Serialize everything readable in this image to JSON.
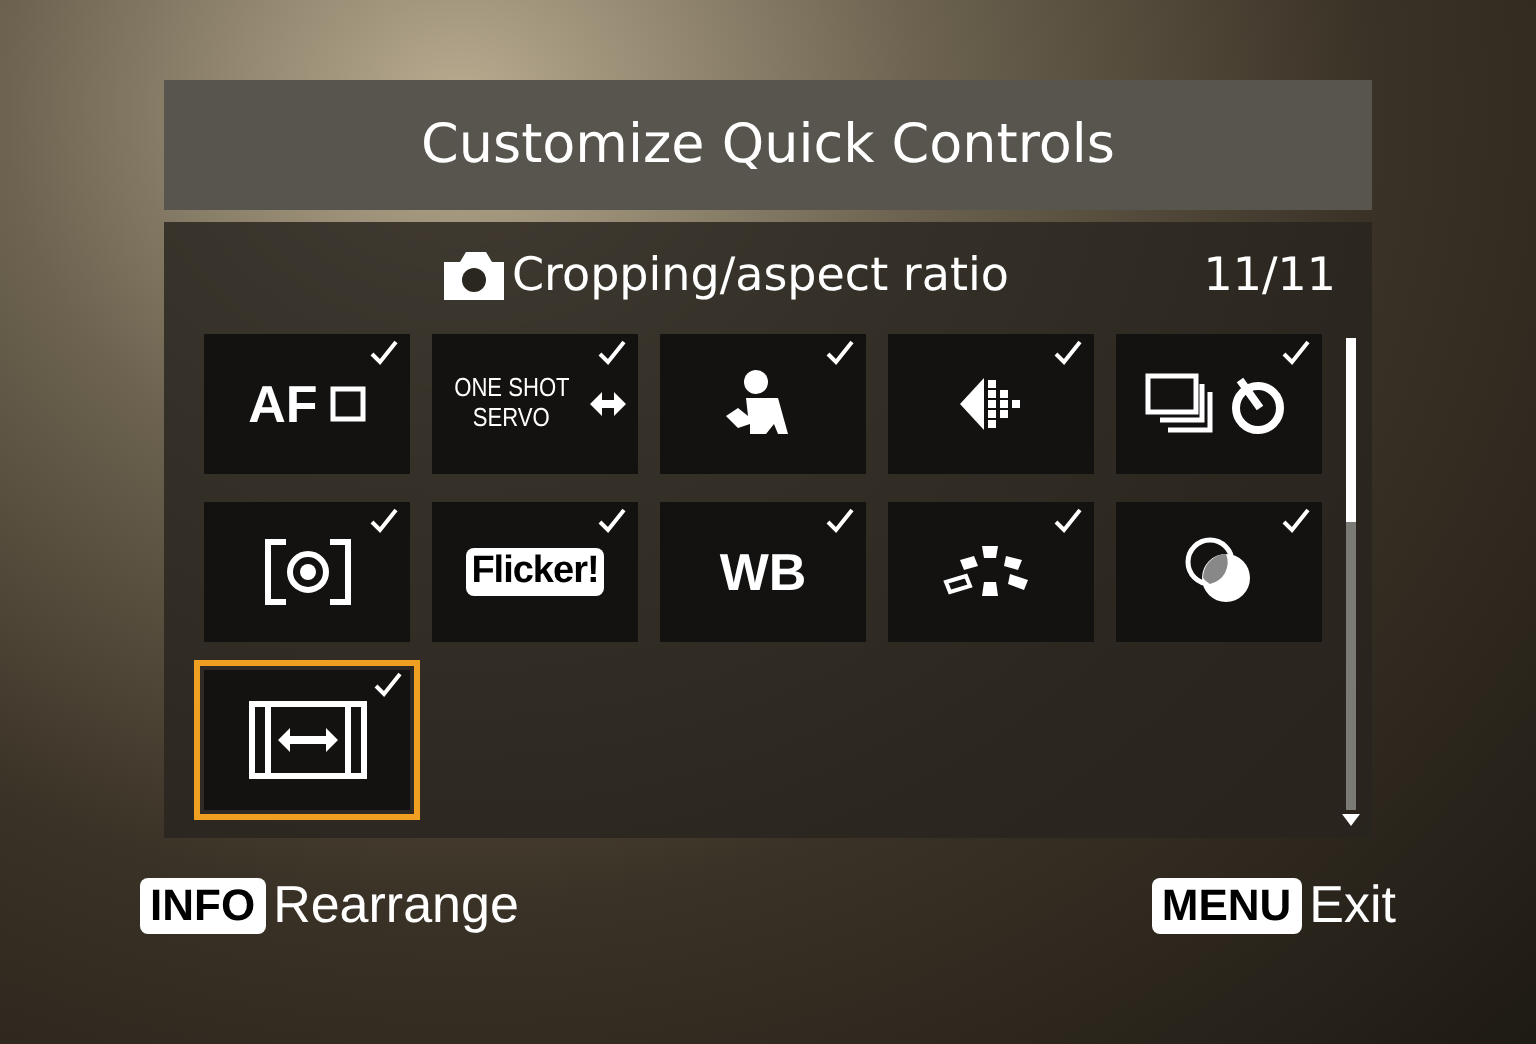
{
  "screen": {
    "title": "Customize Quick Controls"
  },
  "selection": {
    "label": "Cropping/aspect ratio",
    "page": "11/11"
  },
  "tiles": [
    {
      "kind": "afmethod",
      "label": "AF",
      "checked": true,
      "selected": false
    },
    {
      "kind": "afoperation",
      "lines": [
        "ONE SHOT",
        "SERVO"
      ],
      "checked": true,
      "selected": false
    },
    {
      "kind": "tracking",
      "checked": true,
      "selected": false
    },
    {
      "kind": "afpoint",
      "checked": true,
      "selected": false
    },
    {
      "kind": "drive",
      "checked": true,
      "selected": false
    },
    {
      "kind": "metering",
      "checked": true,
      "selected": false
    },
    {
      "kind": "flicker",
      "label": "Flicker!",
      "checked": true,
      "selected": false
    },
    {
      "kind": "wb",
      "label": "WB",
      "checked": true,
      "selected": false
    },
    {
      "kind": "wbshift",
      "checked": true,
      "selected": false
    },
    {
      "kind": "multiexposure",
      "checked": true,
      "selected": false
    },
    {
      "kind": "cropping",
      "checked": true,
      "selected": true
    }
  ],
  "footer": [
    {
      "key": "INFO",
      "action": "Rearrange"
    },
    {
      "key": "MENU",
      "action": "Exit"
    }
  ]
}
